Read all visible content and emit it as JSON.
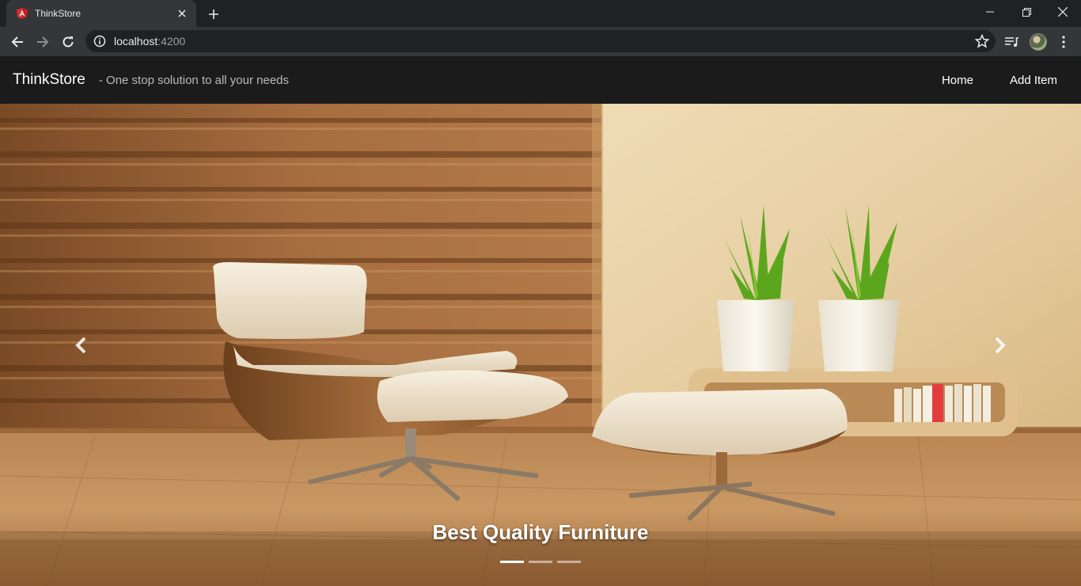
{
  "browser": {
    "tab_title": "ThinkStore",
    "url_host": "localhost",
    "url_port": ":4200",
    "icons": [
      "angular-favicon",
      "close-icon",
      "plus-icon",
      "minimize-icon",
      "restore-icon",
      "window-close-icon",
      "back-arrow-icon",
      "forward-arrow-icon",
      "reload-icon",
      "info-icon",
      "star-icon",
      "media-playlist-icon",
      "profile-avatar",
      "more-vert-icon"
    ]
  },
  "navbar": {
    "brand": "ThinkStore",
    "tagline": "- One stop solution to all your needs",
    "links": [
      {
        "label": "Home"
      },
      {
        "label": "Add Item"
      }
    ]
  },
  "carousel": {
    "caption": "Best Quality Furniture",
    "slide_count": 3,
    "active_index": 0,
    "prev_icon": "chevron-left-icon",
    "next_icon": "chevron-right-icon"
  },
  "colors": {
    "chrome_dark": "#202124",
    "chrome_toolbar": "#35363a",
    "navbar_bg": "#1b1b1c",
    "wood": "#a4683a",
    "wall": "#e9d4ac"
  }
}
